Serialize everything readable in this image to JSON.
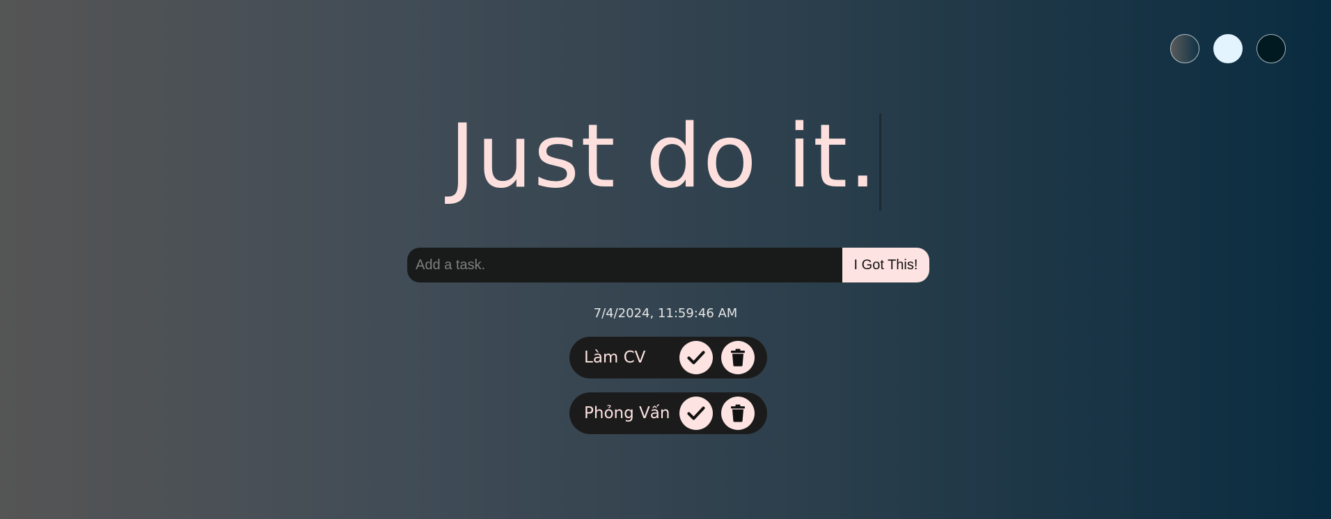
{
  "theme_switcher": {
    "themes": [
      "standard",
      "light",
      "darker"
    ],
    "colors": {
      "standard": "#3d4a54",
      "light": "#e3f4ff",
      "darker": "#011a22"
    }
  },
  "header": {
    "title": "Just do it."
  },
  "task_form": {
    "input_value": "",
    "input_placeholder": "Add a task.",
    "submit_label": "I Got This!"
  },
  "datetime": "7/4/2024, 11:59:46 AM",
  "todos": [
    {
      "text": "Làm CV",
      "check_icon": "check-icon",
      "delete_icon": "trash-icon"
    },
    {
      "text": "Phỏng Vấn",
      "check_icon": "check-icon",
      "delete_icon": "trash-icon"
    }
  ],
  "colors": {
    "accent": "#fde3e1",
    "panel": "#1b1b1b"
  }
}
